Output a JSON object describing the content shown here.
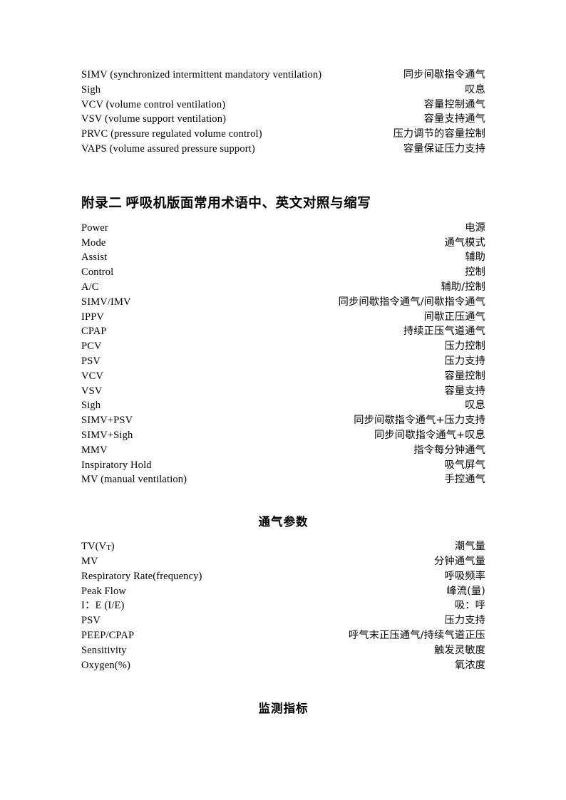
{
  "document": {
    "page_background": "#ffffff",
    "text_color": "#000000"
  },
  "top_block": {
    "rows": [
      {
        "en": "SIMV (synchronized intermittent mandatory ventilation)",
        "zh": "同步间歇指令通气"
      },
      {
        "en": "Sigh",
        "zh": "叹息"
      },
      {
        "en": "VCV (volume control ventilation)",
        "zh": "容量控制通气"
      },
      {
        "en": "VSV (volume support ventilation)",
        "zh": "容量支持通气"
      },
      {
        "en": "PRVC (pressure regulated volume control)",
        "zh": "压力调节的容量控制"
      },
      {
        "en": "VAPS (volume assured pressure support)",
        "zh": "容量保证压力支持"
      }
    ]
  },
  "appendix_heading": {
    "text": "附录二 呼吸机版面常用术语中、英文对照与缩写"
  },
  "panel_terms": {
    "rows": [
      {
        "en": "Power",
        "zh": "电源"
      },
      {
        "en": "Mode",
        "zh": "通气模式"
      },
      {
        "en": "Assist",
        "zh": "辅助"
      },
      {
        "en": "Control",
        "zh": "控制"
      },
      {
        "en": "A/C",
        "zh": "辅助/控制"
      },
      {
        "en": "SIMV/IMV",
        "zh": "同步间歇指令通气/间歇指令通气"
      },
      {
        "en": "IPPV",
        "zh": "间歇正压通气"
      },
      {
        "en": "CPAP",
        "zh": "持续正压气道通气"
      },
      {
        "en": "PCV",
        "zh": "压力控制"
      },
      {
        "en": "PSV",
        "zh": "压力支持"
      },
      {
        "en": "VCV",
        "zh": "容量控制"
      },
      {
        "en": "VSV",
        "zh": "容量支持"
      },
      {
        "en": "Sigh",
        "zh": "叹息"
      },
      {
        "en": "SIMV+PSV",
        "zh": "同步间歇指令通气+压力支持"
      },
      {
        "en": "SIMV+Sigh",
        "zh": "同步间歇指令通气+叹息"
      },
      {
        "en": "MMV",
        "zh": "指令每分钟通气"
      },
      {
        "en": "Inspiratory Hold",
        "zh": "吸气屏气"
      },
      {
        "en": "MV (manual ventilation)",
        "zh": "手控通气"
      }
    ]
  },
  "ventilation_params_heading": {
    "text": "通气参数"
  },
  "ventilation_params": {
    "rows": [
      {
        "en": "TV(VT)",
        "en_base": "TV(V",
        "en_sub": "T",
        "en_tail": ")",
        "zh": "潮气量"
      },
      {
        "en": "MV",
        "zh": "分钟通气量"
      },
      {
        "en": "Respiratory Rate(frequency)",
        "zh": "呼吸频率"
      },
      {
        "en": "Peak Flow",
        "zh": "峰流(量)"
      },
      {
        "en": "I：E (I/E)",
        "zh": "吸：呼"
      },
      {
        "en": "PSV",
        "zh": "压力支持"
      },
      {
        "en": "PEEP/CPAP",
        "zh": "呼气末正压通气/持续气道正压"
      },
      {
        "en": "Sensitivity",
        "zh": "触发灵敏度"
      },
      {
        "en": "Oxygen(%)",
        "zh": "氧浓度"
      }
    ]
  },
  "monitoring_heading": {
    "text": "监测指标"
  }
}
